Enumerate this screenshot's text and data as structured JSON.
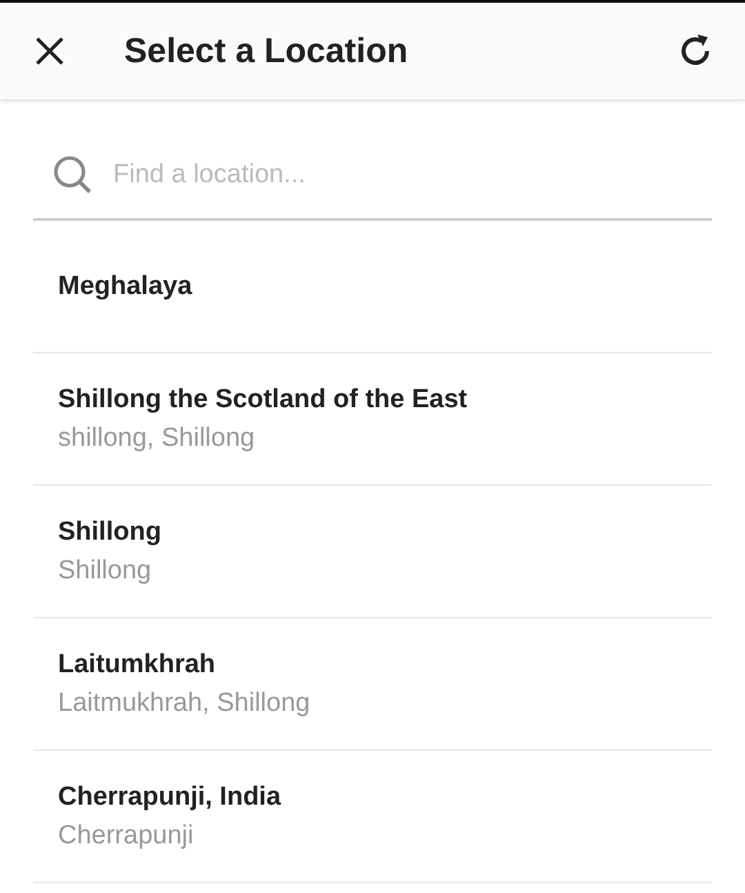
{
  "header": {
    "title": "Select a Location"
  },
  "search": {
    "placeholder": "Find a location..."
  },
  "locations": [
    {
      "name": "Meghalaya"
    },
    {
      "name": "Shillong the Scotland of the East",
      "subtitle": "shillong, Shillong"
    },
    {
      "name": "Shillong",
      "subtitle": "Shillong"
    },
    {
      "name": "Laitumkhrah",
      "subtitle": "Laitmukhrah, Shillong"
    },
    {
      "name": "Cherrapunji, India",
      "subtitle": "Cherrapunji"
    }
  ]
}
